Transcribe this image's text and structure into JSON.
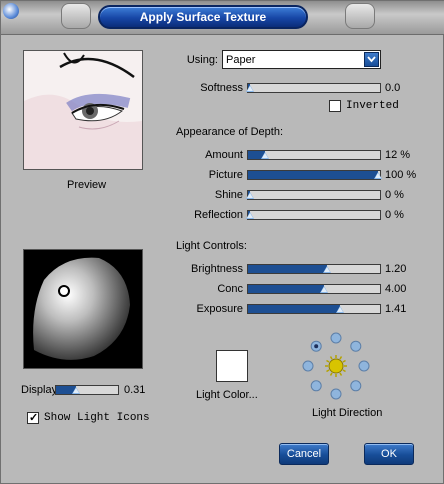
{
  "dialog": {
    "title": "Apply Surface Texture"
  },
  "preview": {
    "caption": "Preview"
  },
  "using": {
    "label": "Using:",
    "value": "Paper"
  },
  "softness": {
    "label": "Softness",
    "value": "0.0",
    "level": 0.0
  },
  "inverted": {
    "label": "Inverted",
    "checked": false
  },
  "appearance": {
    "heading": "Appearance of Depth:",
    "rows": [
      {
        "label": "Amount",
        "value": "12 %",
        "level": 0.12
      },
      {
        "label": "Picture",
        "value": "100 %",
        "level": 1.0
      },
      {
        "label": "Shine",
        "value": "0 %",
        "level": 0.0
      },
      {
        "label": "Reflection",
        "value": "0 %",
        "level": 0.0
      }
    ]
  },
  "light_controls": {
    "heading": "Light Controls:",
    "rows": [
      {
        "label": "Brightness",
        "value": "1.20",
        "level": 0.6
      },
      {
        "label": "Conc",
        "value": "4.00",
        "level": 0.58
      },
      {
        "label": "Exposure",
        "value": "1.41",
        "level": 0.7
      }
    ]
  },
  "display": {
    "label": "Display",
    "value": "0.31",
    "level": 0.31
  },
  "show_light_icons": {
    "label": "Show Light Icons",
    "checked": true
  },
  "light_color": {
    "label": "Light Color...",
    "color": "#ffffff"
  },
  "light_direction": {
    "label": "Light Direction"
  },
  "buttons": {
    "cancel": "Cancel",
    "ok": "OK"
  },
  "colors": {
    "accent": "#1d4f93",
    "dialog_bg": "#b9b9b9"
  }
}
